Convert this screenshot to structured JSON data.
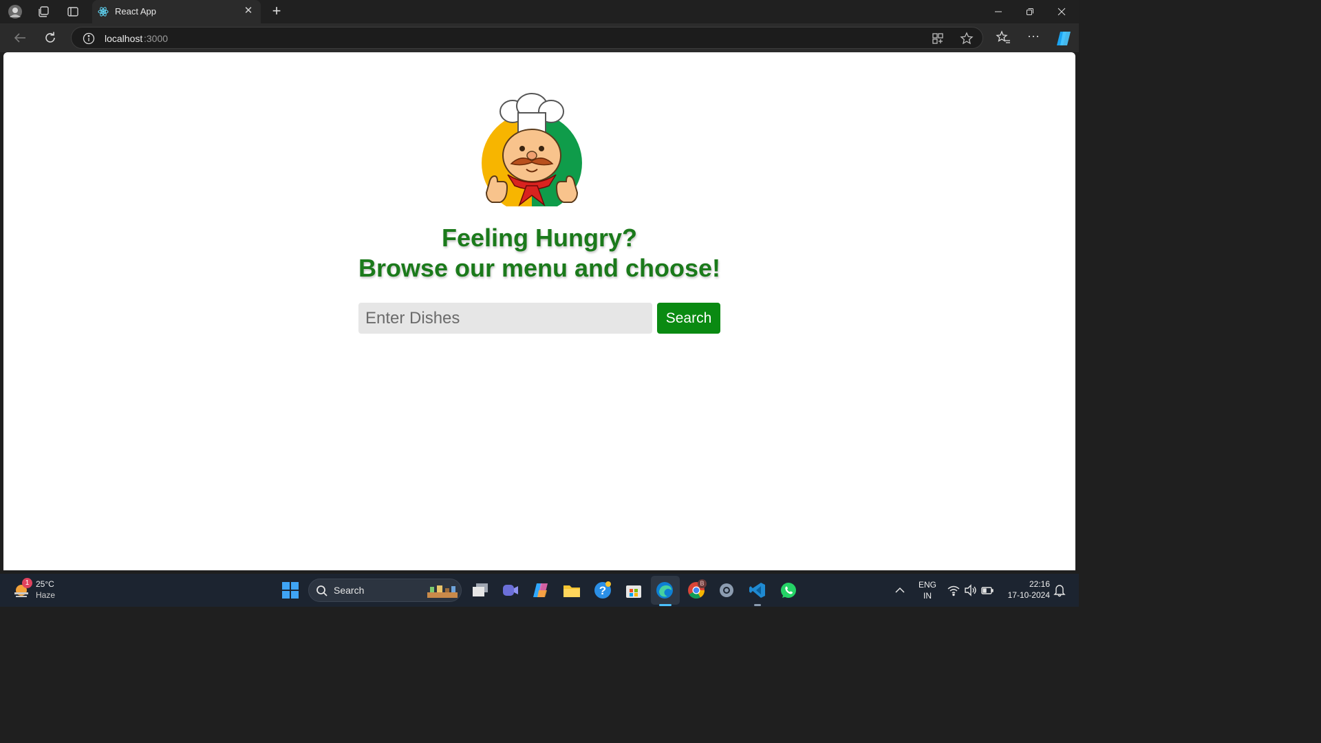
{
  "browser": {
    "tab_title": "React App",
    "url_host": "localhost",
    "url_port": ":3000"
  },
  "page": {
    "heading_line1": "Feeling Hungry?",
    "heading_line2": "Browse our menu and choose!",
    "search_placeholder": "Enter Dishes",
    "search_button_label": "Search"
  },
  "taskbar": {
    "weather_temp": "25°C",
    "weather_desc": "Haze",
    "weather_badge": "1",
    "search_label": "Search",
    "lang_line1": "ENG",
    "lang_line2": "IN",
    "time": "22:16",
    "date": "17-10-2024",
    "chrome_badge": "B"
  },
  "colors": {
    "heading": "#1b7a1b",
    "search_button": "#0a8a12",
    "page_bg": "#ffffff",
    "chrome_bg": "#202020"
  },
  "icons": [
    "profile-avatar-icon",
    "workspaces-icon",
    "tab-actions-icon",
    "react-favicon-icon",
    "close-icon",
    "new-tab-icon",
    "minimize-icon",
    "restore-icon",
    "window-close-icon",
    "back-icon",
    "refresh-icon",
    "site-info-icon",
    "app-available-icon",
    "favorite-star-icon",
    "favorites-icon",
    "more-icon",
    "copilot-icon",
    "chef-logo",
    "weather-icon",
    "windows-start-icon",
    "search-icon",
    "task-view-icon",
    "meet-icon",
    "copilot-app-icon",
    "file-explorer-icon",
    "help-icon",
    "store-icon",
    "edge-icon",
    "chrome-icon",
    "settings-icon",
    "vscode-icon",
    "whatsapp-icon",
    "chevron-up-icon",
    "wifi-icon",
    "volume-icon",
    "battery-icon",
    "notification-bell-icon"
  ]
}
